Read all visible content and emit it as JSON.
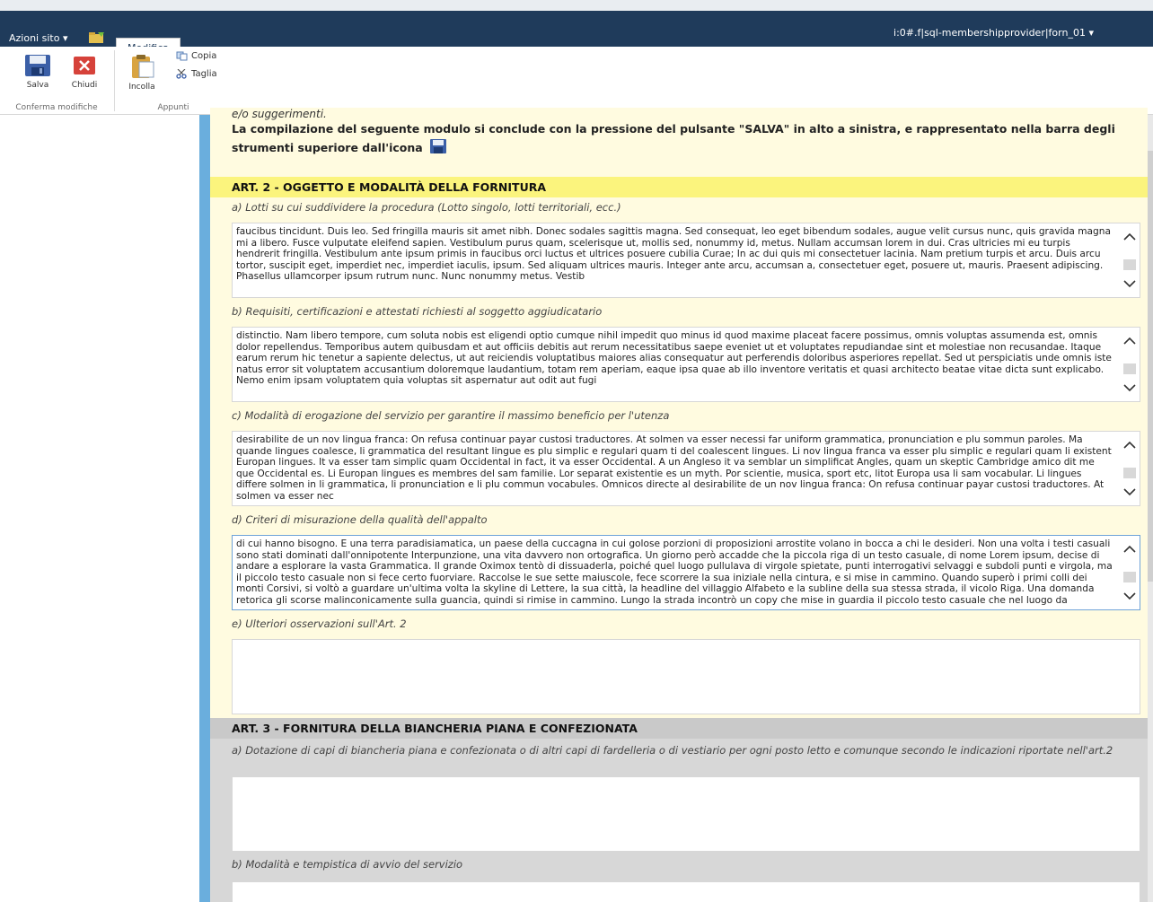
{
  "topbar": {
    "site_actions": "Azioni sito",
    "site_actions_arrow": "▾",
    "tab_label": "Modifica",
    "user": "i:0#.f|sql-membershipprovider|forn_01",
    "user_arrow": "▾"
  },
  "ribbon": {
    "save_label": "Salva",
    "close_label": "Chiudi",
    "paste_label": "Incolla",
    "copy_label": "Copia",
    "cut_label": "Taglia",
    "group1_label": "Conferma modifiche",
    "group2_label": "Appunti"
  },
  "content": {
    "intro_cut": "e/o suggerimenti.",
    "intro_text": "La compilazione del seguente modulo si conclude con la pressione del pulsante \"SALVA\" in alto a sinistra, e rappresentato nella barra degli strumenti superiore dall'icona",
    "art2": {
      "title": "ART. 2 - OGGETTO E MODALITÀ DELLA FORNITURA",
      "a_label": "a) Lotti su cui suddividere la procedura (Lotto singolo, lotti territoriali, ecc.)",
      "a_text": "faucibus tincidunt. Duis leo. Sed fringilla mauris sit amet nibh. Donec sodales sagittis magna. Sed consequat, leo eget bibendum sodales, augue velit cursus nunc, quis gravida magna mi a libero. Fusce vulputate eleifend sapien. Vestibulum purus quam, scelerisque ut, mollis sed, nonummy id, metus. Nullam accumsan lorem in dui. Cras ultricies mi eu turpis hendrerit fringilla. Vestibulum ante ipsum primis in faucibus orci luctus et ultrices posuere cubilia Curae; In ac dui quis mi consectetuer lacinia. Nam pretium turpis et arcu. Duis arcu tortor, suscipit eget, imperdiet nec, imperdiet iaculis, ipsum. Sed aliquam ultrices mauris. Integer ante arcu, accumsan a, consectetuer eget, posuere ut, mauris. Praesent adipiscing. Phasellus ullamcorper ipsum rutrum nunc. Nunc nonummy metus. Vestib",
      "b_label": "b) Requisiti, certificazioni e attestati richiesti al soggetto aggiudicatario",
      "b_text": "distinctio. Nam libero tempore, cum soluta nobis est eligendi optio cumque nihil impedit quo minus id quod maxime placeat facere possimus, omnis voluptas assumenda est, omnis dolor repellendus. Temporibus autem quibusdam et aut officiis debitis aut rerum necessitatibus saepe eveniet ut et voluptates repudiandae sint et molestiae non recusandae. Itaque earum rerum hic tenetur a sapiente delectus, ut aut reiciendis voluptatibus maiores alias consequatur aut perferendis doloribus asperiores repellat. Sed ut perspiciatis unde omnis iste natus error sit voluptatem accusantium doloremque laudantium, totam rem aperiam, eaque ipsa quae ab illo inventore veritatis et quasi architecto beatae vitae dicta sunt explicabo. Nemo enim ipsam voluptatem quia voluptas sit aspernatur aut odit aut fugi",
      "c_label": "c) Modalità di erogazione del servizio per garantire il massimo beneficio per l'utenza",
      "c_text": "desirabilite de un nov lingua franca: On refusa continuar payar custosi traductores. At solmen va esser necessi far uniform grammatica, pronunciation e plu sommun paroles. Ma quande lingues coalesce, li grammatica del resultant lingue es plu simplic e regulari quam ti del coalescent lingues. Li nov lingua franca va esser plu simplic e regulari quam li existent Europan lingues. It va esser tam simplic quam Occidental in fact, it va esser Occidental. A un Angleso it va semblar un simplificat Angles, quam un skeptic Cambridge amico dit me que Occidental es. Li Europan lingues es membres del sam familie. Lor separat existentie es un myth. Por scientie, musica, sport etc, litot Europa usa li sam vocabular. Li lingues differe solmen in li grammatica, li pronunciation e li plu commun vocabules. Omnicos directe al desirabilite de un nov lingua franca: On refusa continuar payar custosi traductores. At solmen va esser nec",
      "d_label": "d) Criteri di misurazione della qualità dell'appalto",
      "d_text": "di cui hanno bisogno. E una terra paradisiamatica, un paese della cuccagna in cui golose porzioni di proposizioni arrostite volano in bocca a chi le desideri. Non una volta i testi casuali sono stati dominati dall'onnipotente Interpunzione, una vita davvero non ortografica. Un giorno però accadde che la piccola riga di un testo casuale, di nome Lorem ipsum, decise di andare a esplorare la vasta Grammatica. Il grande Oximox tentò di dissuaderla, poiché quel luogo pullulava di virgole spietate, punti interrogativi selvaggi e subdoli punti e virgola, ma il piccolo testo casuale non si fece certo fuorviare. Raccolse le sue sette maiuscole, fece scorrere la sua iniziale nella cintura, e si mise in cammino. Quando superò i primi colli dei monti Corsivi, si voltò a guardare un'ultima volta la skyline di Lettere, la sua città, la headline del villaggio Alfabeto e la subline della sua stessa strada, il vicolo Riga. Una domanda retorica gli scorse malinconicamente sulla guancia, quindi si rimise in cammino. Lungo la strada incontrò un copy che mise in guardia il piccolo testo casuale che nel luogo da",
      "e_label": "e) Ulteriori osservazioni sull'Art. 2"
    },
    "art3": {
      "title": "ART. 3 - FORNITURA DELLA BIANCHERIA PIANA E CONFEZIONATA",
      "a_label": "a) Dotazione di capi di biancheria piana e confezionata o di altri capi di fardelleria o di vestiario per ogni posto letto e comunque secondo le indicazioni riportate nell'art.2",
      "b_label": "b) Modalità e tempistica di avvio del servizio"
    }
  },
  "colors": {
    "topbar": "#1f3b5b",
    "stripe": "#6aaedd",
    "yellow_panel": "#fffbe0",
    "yellow_header": "#fbf47d",
    "gray_header": "#c9c9c9"
  }
}
